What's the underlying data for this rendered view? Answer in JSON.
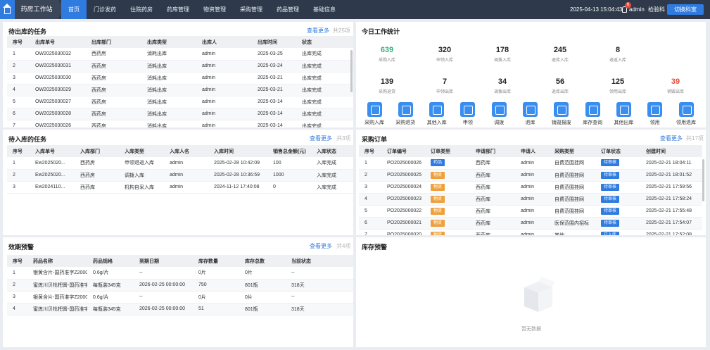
{
  "topbar": {
    "app_title": "药房工作站",
    "nav": [
      "首页",
      "门诊发药",
      "住院药房",
      "药库管理",
      "物资管理",
      "采购管理",
      "药品管理",
      "基础信息"
    ],
    "datetime": "2025-04-13 15:04:43",
    "notification_count": "6",
    "username": "admin",
    "department": "检验科",
    "switch_label": "切换科室"
  },
  "outbound": {
    "title": "待出库的任务",
    "more": "查看更多",
    "total": "共25项",
    "headers": [
      "序号",
      "出库单号",
      "出库部门",
      "出库类型",
      "出库人",
      "出库时间",
      "状态"
    ],
    "rows": [
      [
        "1",
        "OW2025030032",
        "西药房",
        "消耗出库",
        "admin",
        "2025-03-25",
        "出库完成"
      ],
      [
        "2",
        "OW2025030031",
        "西药房",
        "消耗出库",
        "admin",
        "2025-03-24",
        "出库完成"
      ],
      [
        "3",
        "OW2025030030",
        "西药房",
        "消耗出库",
        "admin",
        "2025-03-21",
        "出库完成"
      ],
      [
        "4",
        "OW2025030029",
        "西药房",
        "消耗出库",
        "admin",
        "2025-03-21",
        "出库完成"
      ],
      [
        "5",
        "OW2025030027",
        "西药房",
        "消耗出库",
        "admin",
        "2025-03-14",
        "出库完成"
      ],
      [
        "6",
        "OW2025030028",
        "西药房",
        "消耗出库",
        "admin",
        "2025-03-14",
        "出库完成"
      ],
      [
        "7",
        "OW2025030026",
        "西药房",
        "消耗出库",
        "admin",
        "2025-03-14",
        "出库完成"
      ]
    ]
  },
  "inbound": {
    "title": "待入库的任务",
    "more": "查看更多",
    "total": "共3项",
    "headers": [
      "序号",
      "入库单号",
      "入库部门",
      "入库类型",
      "入库人名",
      "入库时间",
      "销售总金额(元)",
      "入库状态"
    ],
    "rows": [
      [
        "1",
        "Ew2025020...",
        "西药房",
        "申领退返入库",
        "admin",
        "2025-02-28 10:42:09",
        "100",
        "入库完成"
      ],
      [
        "2",
        "Ew2025020...",
        "西药房",
        "调拨入库",
        "admin",
        "2025-02-28 10:36:59",
        "1000",
        "入库完成"
      ],
      [
        "3",
        "Ew2024110...",
        "西药库",
        "机构自采入库",
        "admin",
        "2024-11-12 17:40:08",
        "0",
        "入库完成"
      ]
    ]
  },
  "expiry": {
    "title": "效期预警",
    "more": "查看更多",
    "total": "共4项",
    "headers": [
      "序号",
      "药品名称",
      "药品规格",
      "到期日期",
      "库存数量",
      "库存总数",
      "当前状态"
    ],
    "rows": [
      [
        "1",
        "银黄含片-国药准字Z200000...",
        "0.6g/片",
        "--",
        "0片",
        "0片",
        "--"
      ],
      [
        "2",
        "蜜炼川贝枇杷膏-国药准字Z...",
        "每瓶装345克",
        "2026-02-25 00:00:00",
        "750",
        "801瓶",
        "318天"
      ],
      [
        "3",
        "银黄含片-国药准字Z200000...",
        "0.6g/片",
        "--",
        "0片",
        "0片",
        "--"
      ],
      [
        "4",
        "蜜炼川贝枇杷膏-国药准字Z...",
        "每瓶装345克",
        "2026-02-25 00:00:00",
        "51",
        "801瓶",
        "318天"
      ]
    ]
  },
  "stats": {
    "title": "今日工作统计",
    "items": [
      {
        "num": "639",
        "label": "采购入库",
        "color": "#2db37d"
      },
      {
        "num": "320",
        "label": "申领入库",
        "color": "#222"
      },
      {
        "num": "178",
        "label": "调拨入库",
        "color": "#222"
      },
      {
        "num": "245",
        "label": "退库入库",
        "color": "#222"
      },
      {
        "num": "8",
        "label": "退返入库",
        "color": "#222"
      },
      {
        "num": "139",
        "label": "采购退货",
        "color": "#222"
      },
      {
        "num": "7",
        "label": "申领出库",
        "color": "#222"
      },
      {
        "num": "34",
        "label": "调拨出库",
        "color": "#222"
      },
      {
        "num": "56",
        "label": "退库出库",
        "color": "#222"
      },
      {
        "num": "125",
        "label": "领用出库",
        "color": "#222"
      },
      {
        "num": "39",
        "label": "销毁出库",
        "color": "#e74c3c"
      }
    ],
    "actions": [
      "采购入库",
      "采购退货",
      "其他入库",
      "申领",
      "调拨",
      "退库",
      "销毁报废",
      "库存查询",
      "其他出库",
      "领用",
      "领用退库"
    ]
  },
  "purchase": {
    "title": "采购订单",
    "more": "查看更多",
    "total": "共17项",
    "headers": [
      "序号",
      "订单编号",
      "订单类型",
      "申请部门",
      "申请人",
      "采购类型",
      "订单状态",
      "创建时间"
    ],
    "rows": [
      [
        "1",
        "PO2025000026",
        "药品",
        "西药库",
        "admin",
        "自费范围挂网",
        "待审核",
        "2025-02-21 18:04:11"
      ],
      [
        "2",
        "PO2025000025",
        "物资",
        "西药库",
        "admin",
        "自费范围挂网",
        "待审核",
        "2025-02-21 18:01:52"
      ],
      [
        "3",
        "PO2025000024",
        "物资",
        "西药库",
        "admin",
        "自费范围挂网",
        "待审核",
        "2025-02-21 17:59:56"
      ],
      [
        "4",
        "PO2025000023",
        "物资",
        "西药库",
        "admin",
        "自费范围挂网",
        "待审核",
        "2025-02-21 17:58:24"
      ],
      [
        "5",
        "PO2025000022",
        "物资",
        "西药库",
        "admin",
        "自费范围挂网",
        "待审核",
        "2025-02-21 17:55:48"
      ],
      [
        "6",
        "PO2025000021",
        "物资",
        "西药库",
        "admin",
        "医保范围内招标",
        "待审核",
        "2025-02-21 17:54:07"
      ],
      [
        "7",
        "PO2025000020",
        "物资",
        "西药库",
        "admin",
        "其他",
        "已入库",
        "2025-02-21 17:52:08"
      ]
    ]
  },
  "stock_alert": {
    "title": "库存预警",
    "empty": "暂无数据"
  }
}
